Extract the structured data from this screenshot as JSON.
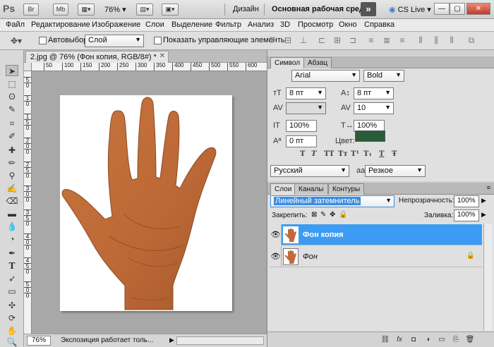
{
  "app": {
    "logo": "Ps",
    "bridge_button": "Br",
    "minibridge_button": "Mb",
    "zoom": "76%",
    "workspace_design": "Дизайн",
    "workspace_essentials": "Основная рабочая среда",
    "cs_live": "CS Live"
  },
  "menu": [
    "Файл",
    "Редактирование",
    "Изображение",
    "Слои",
    "Выделение",
    "Фильтр",
    "Анализ",
    "3D",
    "Просмотр",
    "Окно",
    "Справка"
  ],
  "options": {
    "autoselect_label": "Автовыбор:",
    "autoselect_value": "Слой",
    "show_transform_label": "Показать управляющие элементы"
  },
  "document": {
    "tab_title": "2.jpg @ 76% (Фон копия, RGB/8#) *",
    "ruler_h": [
      "50",
      "100",
      "150",
      "200",
      "250",
      "300",
      "350",
      "400",
      "450",
      "500",
      "550",
      "600"
    ],
    "ruler_v": [
      "5",
      "0",
      "1",
      "0",
      "1",
      "5",
      "0",
      "2",
      "0",
      "0",
      "2",
      "5",
      "0",
      "3",
      "0",
      "0",
      "3",
      "5",
      "0",
      "4",
      "0",
      "0",
      "4",
      "5",
      "0",
      "5",
      "0",
      "0"
    ]
  },
  "status": {
    "zoom": "76%",
    "info": "Экспозиция работает толь..."
  },
  "character_panel": {
    "tabs": [
      "Символ",
      "Абзац"
    ],
    "font_family": "Arial",
    "font_style": "Bold",
    "font_size": "8 пт",
    "leading": "8 пт",
    "kerning": "",
    "tracking": "10",
    "vertical_scale": "100%",
    "horizontal_scale": "100%",
    "baseline_shift": "0 пт",
    "color_label": "Цвет:",
    "text_color": "#2a5c3a",
    "format_buttons": [
      "T",
      "T",
      "TT",
      "Tт",
      "T¹",
      "T₁",
      "T",
      "Ŧ"
    ],
    "language": "Русский",
    "aa_icon": "aa",
    "antialias": "Резкое"
  },
  "layers_panel": {
    "tabs": [
      "Слои",
      "Каналы",
      "Контуры"
    ],
    "blend_mode": "Линейный затемнитель",
    "opacity_label": "Непрозрачность:",
    "opacity": "100%",
    "lock_label": "Закрепить:",
    "fill_label": "Заливка:",
    "fill": "100%",
    "layers": [
      {
        "name": "Фон копия",
        "selected": true
      },
      {
        "name": "Фон",
        "selected": false
      }
    ]
  },
  "colors": {
    "selected_layer": "#3c9cf3",
    "blend_highlight": "#3c8ce0",
    "skin": "#c1693a"
  }
}
